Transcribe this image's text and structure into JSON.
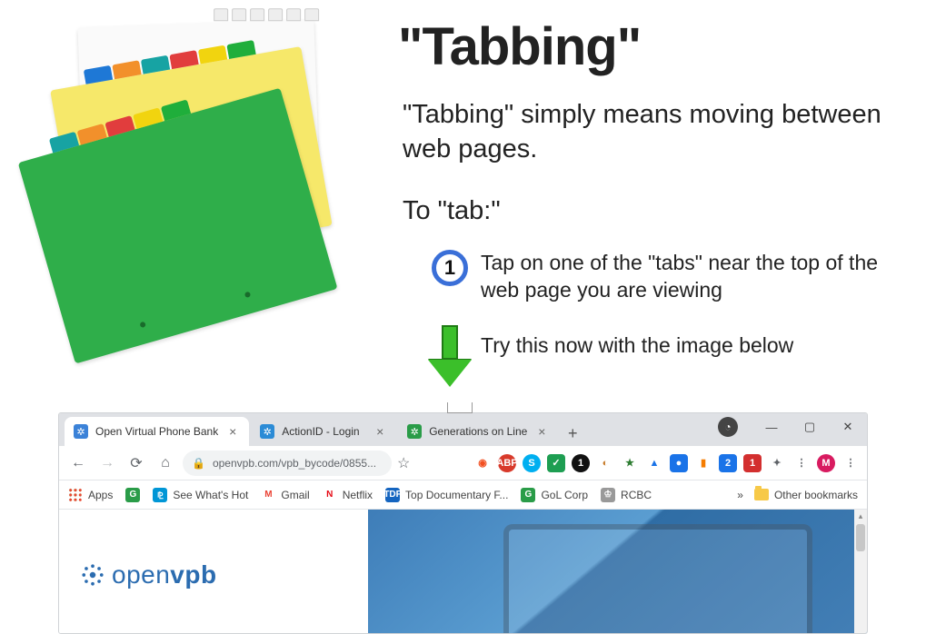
{
  "heading": "\"Tabbing\"",
  "subtitle": "\"Tabbing\" simply means moving between web pages.",
  "to_tab_label": "To \"tab:\"",
  "step": {
    "number": "1",
    "text": "Tap on one of the \"tabs\" near the top of the web page you are viewing"
  },
  "try_text": "Try this now with the image below",
  "browser": {
    "tabs": [
      {
        "title": "Open Virtual Phone Bank",
        "favicon": "fv-openvpb",
        "active": true
      },
      {
        "title": "ActionID - Login",
        "favicon": "fv-actionid",
        "active": false
      },
      {
        "title": "Generations on Line",
        "favicon": "fv-gol",
        "active": false
      }
    ],
    "new_tab_glyph": "+",
    "window_controls": {
      "minimize": "—",
      "maximize": "▢",
      "close": "✕"
    },
    "incognito_glyph": "◔",
    "nav": {
      "back": "←",
      "forward": "→",
      "reload": "⟳",
      "home": "⌂"
    },
    "omnibox": {
      "lock": "🔒",
      "url": "openvpb.com/vpb_bycode/0855...",
      "star": "☆"
    },
    "extensions": [
      {
        "name": "brave-icon",
        "bg": "#fff",
        "fg": "#f25022",
        "glyph": "◉",
        "round": false
      },
      {
        "name": "adblock-icon",
        "bg": "#d83a2b",
        "fg": "#fff",
        "glyph": "ABP",
        "round": true
      },
      {
        "name": "skype-icon",
        "bg": "#00aff0",
        "fg": "#fff",
        "glyph": "S",
        "round": true
      },
      {
        "name": "check-icon",
        "bg": "#1e9e52",
        "fg": "#fff",
        "glyph": "✓",
        "round": false
      },
      {
        "name": "one-icon",
        "bg": "#111",
        "fg": "#fff",
        "glyph": "1",
        "round": true
      },
      {
        "name": "dog-icon",
        "bg": "#fff",
        "fg": "#c77b2a",
        "glyph": "◐",
        "round": true
      },
      {
        "name": "new-icon",
        "bg": "#fff",
        "fg": "#2e7d32",
        "glyph": "★",
        "round": false
      },
      {
        "name": "drive-icon",
        "bg": "#fff",
        "fg": "#1a73e8",
        "glyph": "▲",
        "round": false
      },
      {
        "name": "blue-icon",
        "bg": "#1a73e8",
        "fg": "#fff",
        "glyph": "●",
        "round": false
      },
      {
        "name": "ga-icon",
        "bg": "#fff",
        "fg": "#f57c00",
        "glyph": "▮",
        "round": false
      },
      {
        "name": "badge2-icon",
        "bg": "#1a73e8",
        "fg": "#fff",
        "glyph": "2",
        "round": false
      },
      {
        "name": "badge1-icon",
        "bg": "#d32f2f",
        "fg": "#fff",
        "glyph": "1",
        "round": false
      },
      {
        "name": "puzzle-icon",
        "bg": "transparent",
        "fg": "#5f6368",
        "glyph": "✦",
        "round": false
      },
      {
        "name": "menu-icon",
        "bg": "transparent",
        "fg": "#5f6368",
        "glyph": "⋮",
        "round": false
      },
      {
        "name": "avatar-icon",
        "bg": "#d81b60",
        "fg": "#fff",
        "glyph": "M",
        "round": true
      },
      {
        "name": "kebab-icon",
        "bg": "transparent",
        "fg": "#5f6368",
        "glyph": "⋮",
        "round": false
      }
    ],
    "bookmarks": {
      "apps_label": "Apps",
      "items": [
        {
          "label": "",
          "ico_bg": "#2a9c48",
          "ico_fg": "#fff",
          "glyph": "G"
        },
        {
          "label": "See What's Hot",
          "ico_bg": "#0096d6",
          "ico_fg": "#fff",
          "glyph": "⅊"
        },
        {
          "label": "Gmail",
          "ico_bg": "#fff",
          "ico_fg": "#ea4335",
          "glyph": "M"
        },
        {
          "label": "Netflix",
          "ico_bg": "#fff",
          "ico_fg": "#e50914",
          "glyph": "N"
        },
        {
          "label": "Top Documentary F...",
          "ico_bg": "#1565c0",
          "ico_fg": "#fff",
          "glyph": "TDF"
        },
        {
          "label": "GoL Corp",
          "ico_bg": "#2a9c48",
          "ico_fg": "#fff",
          "glyph": "G"
        },
        {
          "label": "RCBC",
          "ico_bg": "#999",
          "ico_fg": "#fff",
          "glyph": "♔"
        }
      ],
      "overflow": "»",
      "other_label": "Other bookmarks"
    },
    "page_brand": {
      "open": "open",
      "vpb": "vpb"
    }
  }
}
